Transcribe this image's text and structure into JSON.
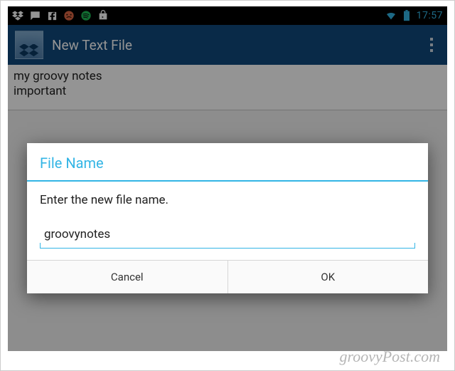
{
  "status": {
    "clock": "17:57"
  },
  "actionbar": {
    "title": "New Text File"
  },
  "editor": {
    "line1": "my groovy notes",
    "line2": "important"
  },
  "dialog": {
    "title": "File Name",
    "message": "Enter the new file name.",
    "input_value": "groovynotes",
    "cancel": "Cancel",
    "ok": "OK"
  },
  "watermark": "groovyPost.com"
}
